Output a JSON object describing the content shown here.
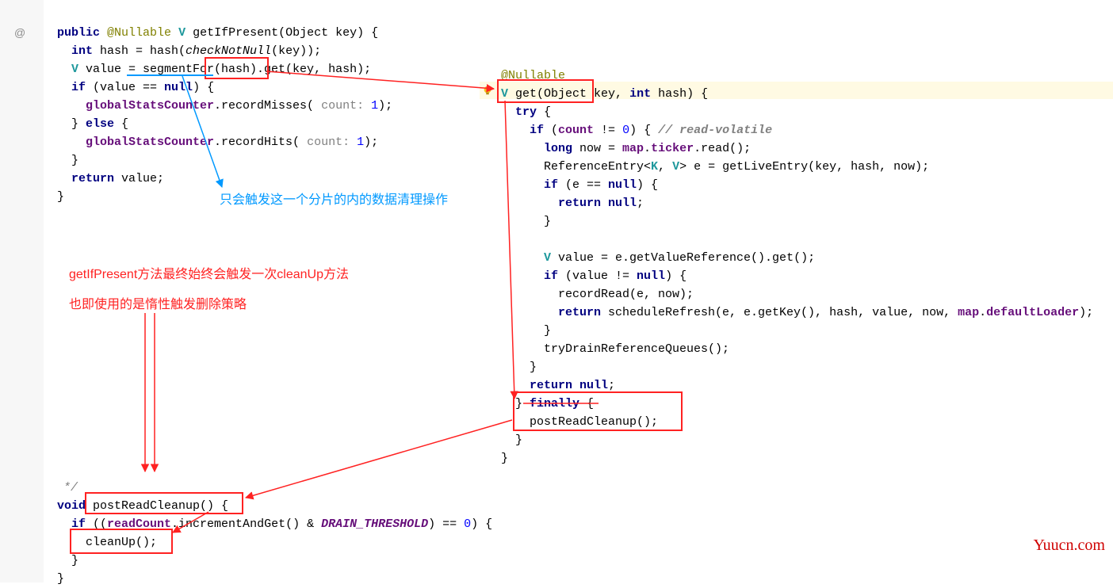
{
  "gutter": {
    "at": "@"
  },
  "left": {
    "l1a": "public",
    "l1b": "@Nullable",
    "l1c": "V ",
    "l1d": "getIfPresent",
    "l1e": "(Object key) {",
    "l2a": "int",
    "l2b": " hash = hash(",
    "l2c": "checkNotNull",
    "l2d": "(key));",
    "l3a": "V ",
    "l3b": "value = segmentFor(hash).get(key, hash);",
    "l4a": "if",
    "l4b": " (value == ",
    "l4c": "null",
    "l4d": ") {",
    "l5a": "globalStatsCounter",
    "l5b": ".recordMisses(",
    "l5c": "count:",
    "l5d": " 1",
    "l5e": ");",
    "l6a": "} ",
    "l6b": "else",
    "l6c": " {",
    "l7a": "globalStatsCounter",
    "l7b": ".recordHits(",
    "l7c": "count:",
    "l7d": " 1",
    "l7e": ");",
    "l8": "}",
    "l9a": "return",
    "l9b": " value;",
    "l10": "}"
  },
  "right": {
    "r0": "@Nullable",
    "r1a": "V ",
    "r1b": "get",
    "r1c": "(Object key, ",
    "r1d": "int",
    "r1e": " hash) {",
    "r2a": "try",
    "r2b": " {",
    "r3a": "if",
    "r3b": " (",
    "r3c": "count",
    "r3d": " != ",
    "r3e": "0",
    "r3f": ") { ",
    "r3g": "// read-volatile",
    "r4a": "long",
    "r4b": " now = ",
    "r4c": "map",
    "r4d": ".",
    "r4e": "ticker",
    "r4f": ".read();",
    "r5a": "ReferenceEntry<",
    "r5b": "K",
    "r5c": ", ",
    "r5d": "V",
    "r5e": "> e = getLiveEntry(key, hash, now);",
    "r6a": "if",
    "r6b": " (e == ",
    "r6c": "null",
    "r6d": ") {",
    "r7a": "return null",
    "r7b": ";",
    "r8": "}",
    "r9": "",
    "r10a": "V ",
    "r10b": "value = e.getValueReference().get();",
    "r11a": "if",
    "r11b": " (value != ",
    "r11c": "null",
    "r11d": ") {",
    "r12": "recordRead(e, now);",
    "r13a": "return",
    "r13b": " scheduleRefresh(e, e.getKey(), hash, value, now, ",
    "r13c": "map",
    "r13d": ".",
    "r13e": "defaultLoader",
    "r13f": ");",
    "r14": "}",
    "r15": "tryDrainReferenceQueues();",
    "r16": "}",
    "r17a": "return null",
    "r17b": ";",
    "r18a": "} ",
    "r18b": "finally",
    "r18c": " {",
    "r19": "postReadCleanup();",
    "r20": "}",
    "r21": "}"
  },
  "bottom": {
    "b0": "*/",
    "b1a": "void",
    "b1b": " postReadCleanup() {",
    "b2a": "if",
    "b2b": " ((",
    "b2c": "readCount",
    "b2d": ".incrementAndGet() & ",
    "b2e": "DRAIN_THRESHOLD",
    "b2f": ") == ",
    "b2g": "0",
    "b2h": ") {",
    "b3": "cleanUp();",
    "b4": "}",
    "b5": "}"
  },
  "notes": {
    "blue": "只会触发这一个分片的内的数据清理操作",
    "red1": "getIfPresent方法最终始终会触发一次cleanUp方法",
    "red2": "也即使用的是惰性触发删除策略"
  },
  "watermark": "Yuucn.com"
}
